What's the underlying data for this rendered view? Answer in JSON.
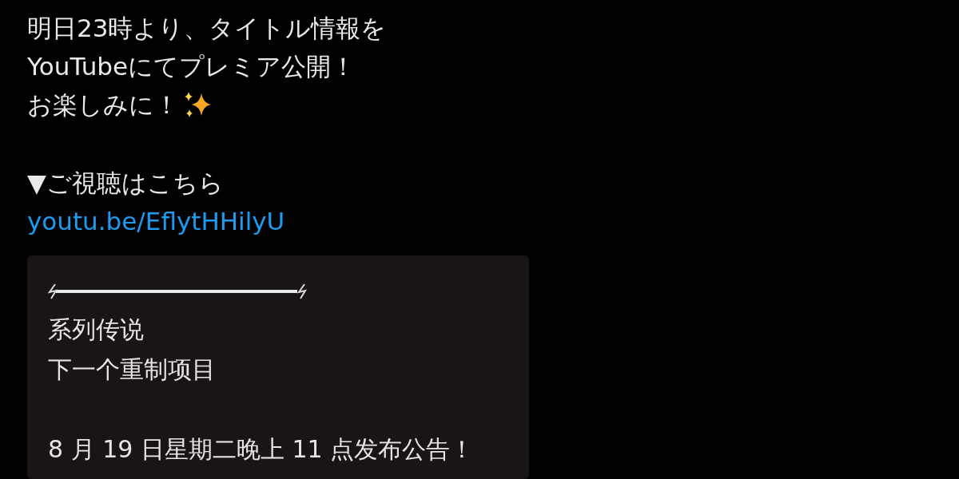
{
  "post": {
    "paragraphs": [
      [
        "明日23時より、タイトル情報を",
        "YouTubeにてプレミア公開！",
        "お楽しみに！"
      ],
      [
        "▼ご視聴はこちら"
      ]
    ],
    "link": "youtu.be/EflytHHilyU"
  },
  "translation_card": {
    "paragraphs": [
      [
        "系列传说",
        "下一个重制项目"
      ],
      [
        "8 月 19 日星期二晚上 11 点发布公告！"
      ]
    ]
  }
}
